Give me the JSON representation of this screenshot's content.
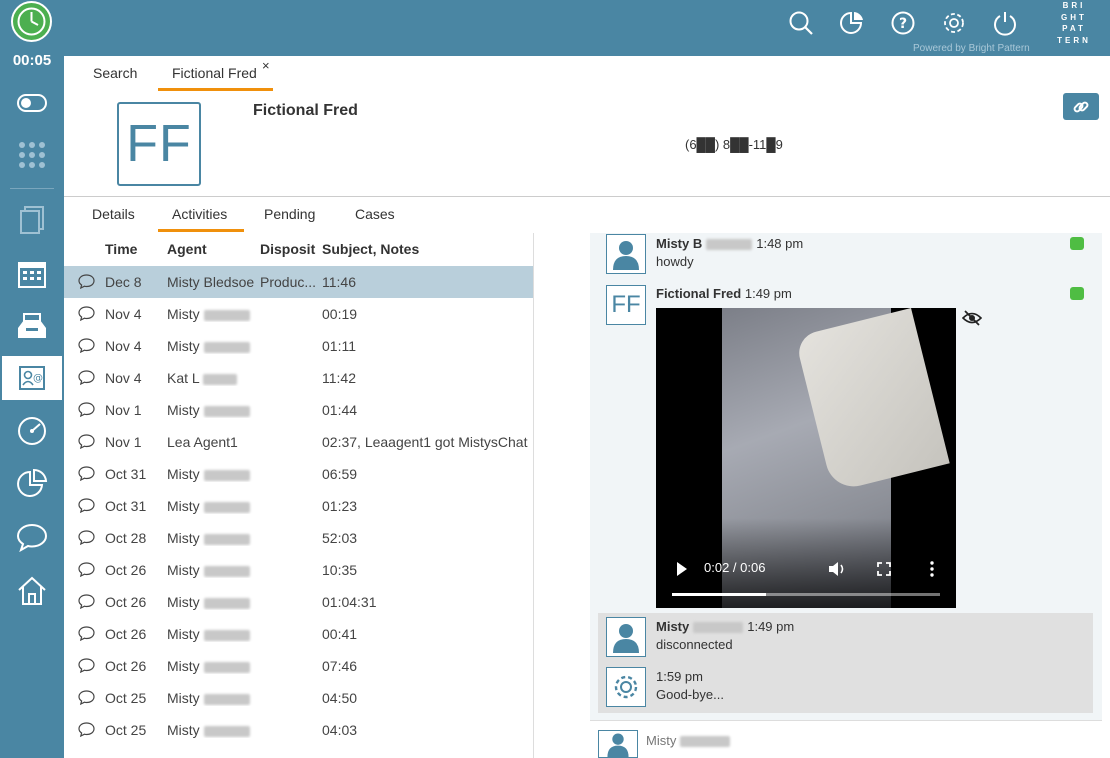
{
  "app": {
    "timer": "00:05",
    "brand_lines": [
      "BRI",
      "GHT",
      "PAT",
      "TERN"
    ],
    "powered_by": "Powered by Bright Pattern"
  },
  "top_tabs": [
    {
      "label": "Search"
    },
    {
      "label": "Fictional Fred"
    }
  ],
  "tab_close": "×",
  "contact": {
    "initials": "FF",
    "name": "Fictional Fred",
    "phone": "(6██) 8██-11█9"
  },
  "sub_tabs": [
    {
      "label": "Details"
    },
    {
      "label": "Activities"
    },
    {
      "label": "Pending"
    },
    {
      "label": "Cases"
    }
  ],
  "table": {
    "headers": {
      "time": "Time",
      "agent": "Agent",
      "disposition": "Dispositi",
      "subject": "Subject, Notes"
    },
    "rows": [
      {
        "time": "Dec 8",
        "agent": "Misty Bledsoe",
        "disposition": "Produc...",
        "subject": "11:46"
      },
      {
        "time": "Nov 4",
        "agent": "Misty",
        "disposition": "",
        "subject": "00:19"
      },
      {
        "time": "Nov 4",
        "agent": "Misty",
        "disposition": "",
        "subject": "01:11"
      },
      {
        "time": "Nov 4",
        "agent": "Kat L",
        "disposition": "",
        "subject": "11:42"
      },
      {
        "time": "Nov 1",
        "agent": "Misty",
        "disposition": "",
        "subject": "01:44"
      },
      {
        "time": "Nov 1",
        "agent": "Lea Agent1",
        "disposition": "",
        "subject": "02:37, Leaagent1 got MistysChat"
      },
      {
        "time": "Oct 31",
        "agent": "Misty",
        "disposition": "",
        "subject": "06:59"
      },
      {
        "time": "Oct 31",
        "agent": "Misty",
        "disposition": "",
        "subject": "01:23"
      },
      {
        "time": "Oct 28",
        "agent": "Misty",
        "disposition": "",
        "subject": "52:03"
      },
      {
        "time": "Oct 26",
        "agent": "Misty",
        "disposition": "",
        "subject": "10:35"
      },
      {
        "time": "Oct 26",
        "agent": "Misty",
        "disposition": "",
        "subject": "01:04:31"
      },
      {
        "time": "Oct 26",
        "agent": "Misty",
        "disposition": "",
        "subject": "00:41"
      },
      {
        "time": "Oct 26",
        "agent": "Misty",
        "disposition": "",
        "subject": "07:46"
      },
      {
        "time": "Oct 25",
        "agent": "Misty",
        "disposition": "",
        "subject": "04:50"
      },
      {
        "time": "Oct 25",
        "agent": "Misty",
        "disposition": "",
        "subject": "04:03"
      }
    ]
  },
  "chat": {
    "msg1": {
      "name": "Misty B",
      "time": "1:48 pm",
      "text": "howdy"
    },
    "msg2": {
      "initials": "FF",
      "name": "Fictional Fred",
      "time": "1:49 pm"
    },
    "video": {
      "time": "0:02 / 0:06",
      "progress": 0.35
    },
    "msg3": {
      "name": "Misty",
      "time": "1:49 pm",
      "text": "disconnected"
    },
    "msg4": {
      "time": "1:59 pm",
      "text": "Good-bye..."
    },
    "bottom_name": "Misty"
  },
  "colors": {
    "brand": "#4a86a3",
    "accent": "#f0900c",
    "line_green": "#4fbd43",
    "selected_row": "#b9cfdb"
  }
}
